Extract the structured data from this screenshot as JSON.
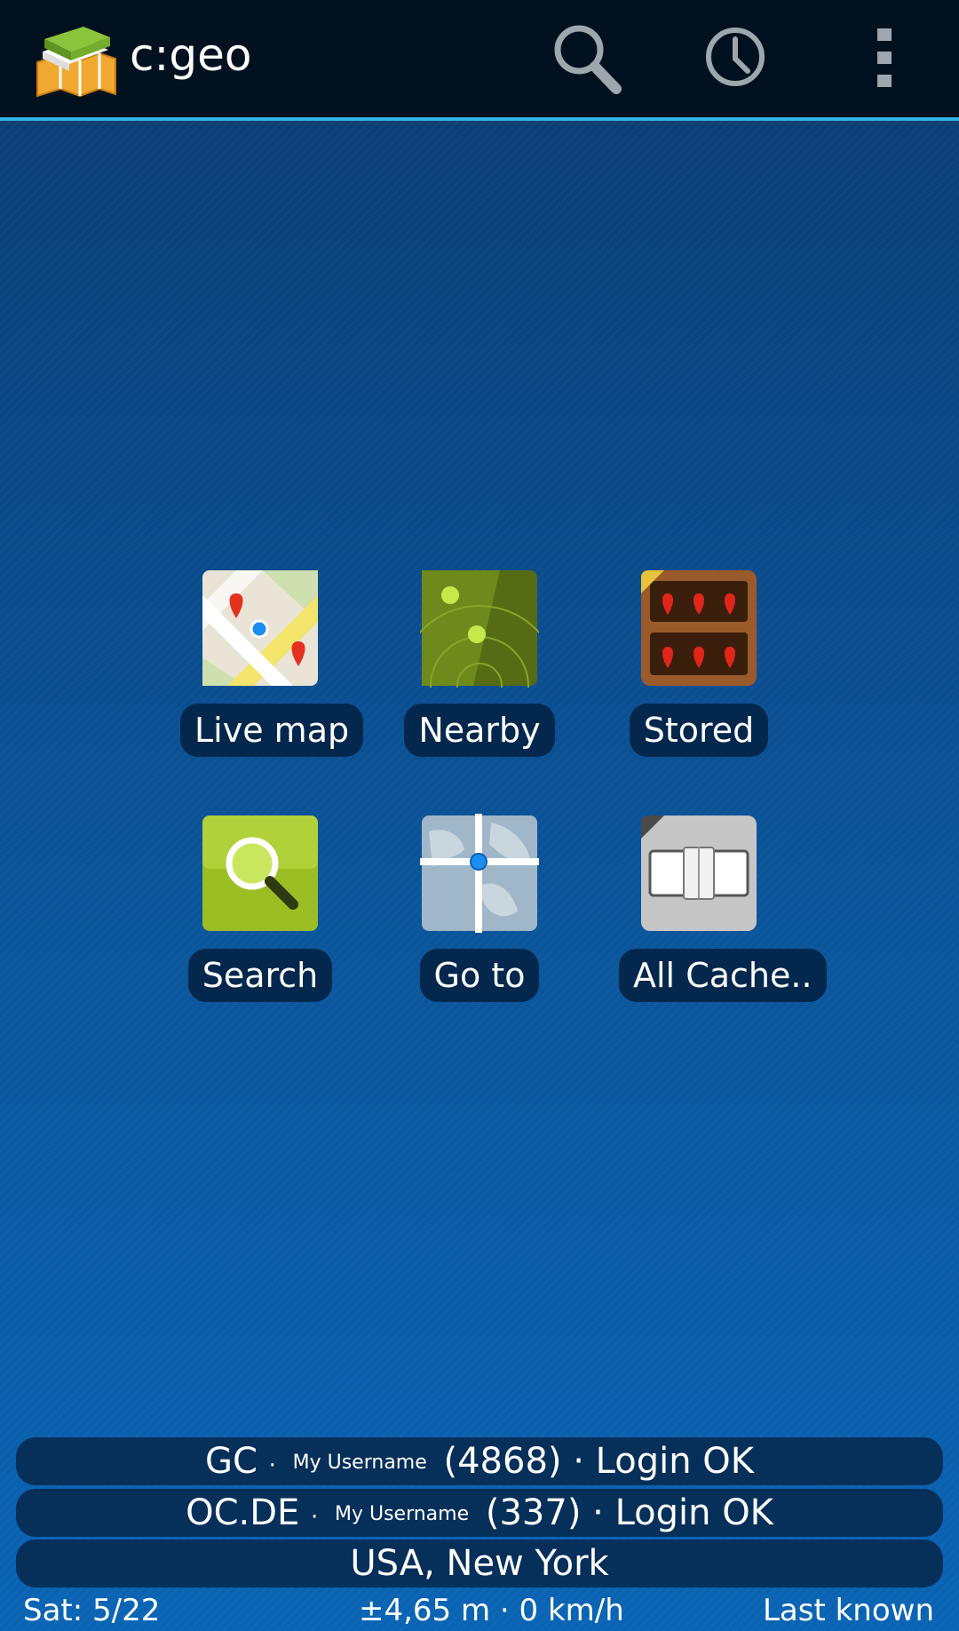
{
  "app": {
    "title": "c:geo"
  },
  "actions": {
    "search": "search-icon",
    "history": "history-clock-icon",
    "overflow": "overflow-menu-icon"
  },
  "tiles": [
    {
      "label": "Live map",
      "icon": "live-map-icon"
    },
    {
      "label": "Nearby",
      "icon": "nearby-radar-icon"
    },
    {
      "label": "Stored",
      "icon": "stored-shelf-icon"
    },
    {
      "label": "Search",
      "icon": "search-magnifier-icon"
    },
    {
      "label": "Go to",
      "icon": "go-to-globe-icon"
    },
    {
      "label": "All Cache..",
      "icon": "all-caches-icon"
    }
  ],
  "status": {
    "gc": {
      "service": "GC",
      "sep": "·",
      "user": "My Username",
      "count": "(4868)",
      "state": "· Login OK"
    },
    "oc": {
      "service": "OC.DE",
      "sep": "·",
      "user": "My Username",
      "count": "(337)",
      "state": "· Login OK"
    },
    "location": "USA, New York"
  },
  "footer": {
    "sat": "Sat: 5/22",
    "accuracy": "±4,65 m · 0 km/h",
    "fix": "Last known"
  }
}
